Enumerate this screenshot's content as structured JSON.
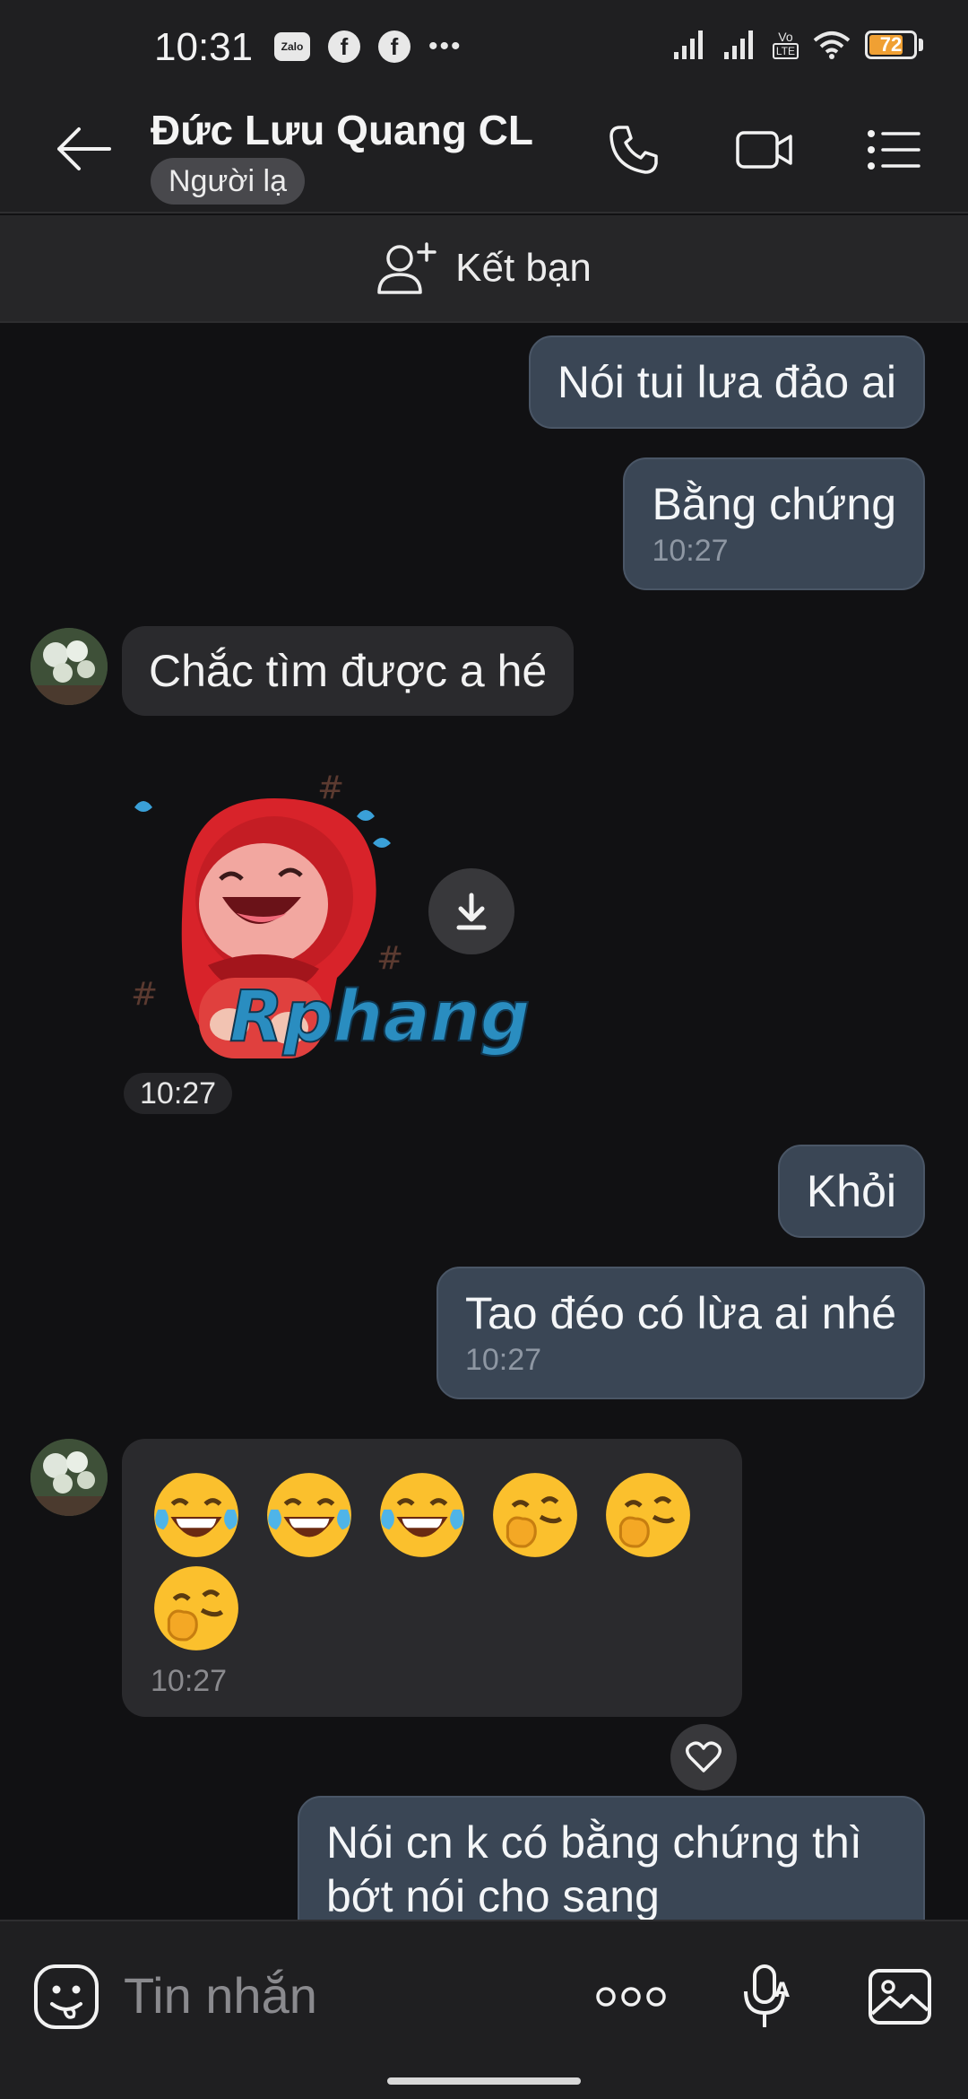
{
  "status_bar": {
    "time": "10:31",
    "app_icons": [
      "zalo-icon",
      "facebook-icon",
      "facebook-icon"
    ],
    "zalo_label": "Zalo",
    "volte_label": "Vo",
    "lte_label": "LTE",
    "battery_level": "72"
  },
  "header": {
    "contact_name": "Đức Lưu Quang CL",
    "relation_tag": "Người lạ"
  },
  "add_friend": {
    "label": "Kết bạn"
  },
  "messages": [
    {
      "direction": "out",
      "text": "Nói tui lưa đảo ai"
    },
    {
      "direction": "out",
      "text": "Bằng chứng",
      "time": "10:27"
    },
    {
      "direction": "in",
      "text": "Chắc tìm được a hé"
    },
    {
      "direction": "in",
      "type": "sticker",
      "sticker_text": "Rphang",
      "time": "10:27"
    },
    {
      "direction": "out",
      "text": "Khỏi"
    },
    {
      "direction": "out",
      "text": "Tao đéo có lừa ai nhé",
      "time": "10:27"
    },
    {
      "direction": "in",
      "type": "emoji",
      "emojis": [
        "laughing-tears",
        "laughing-tears",
        "laughing-tears",
        "giggle",
        "giggle",
        "giggle"
      ],
      "time": "10:27"
    },
    {
      "direction": "out",
      "text_line1": "Nói cn k có bằng chứng thì",
      "text_line2": "bớt nói cho sang"
    }
  ],
  "input_bar": {
    "placeholder": "Tin nhắn"
  },
  "colors": {
    "background": "#111113",
    "header": "#1f1f21",
    "outgoing_bubble": "#3a4655",
    "incoming_bubble": "#2a2a2d",
    "battery": "#f0a033"
  }
}
